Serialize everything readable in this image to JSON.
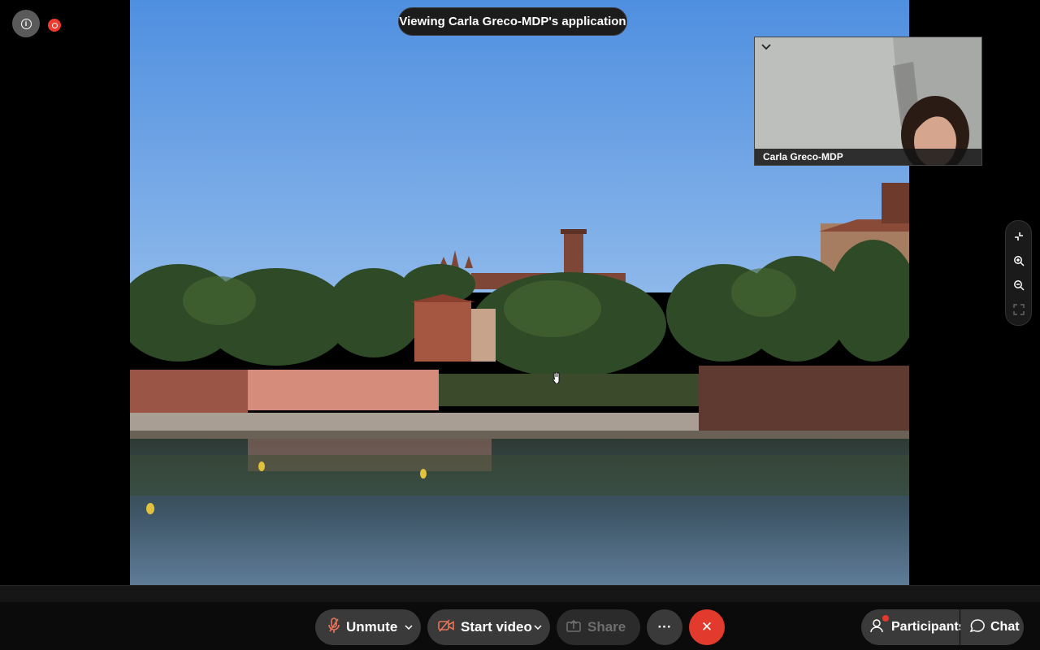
{
  "banner": {
    "text": "Viewing Carla Greco-MDP's application"
  },
  "self_view": {
    "name": "Carla Greco-MDP"
  },
  "icons": {
    "info": "info-icon",
    "recording": "recording-icon",
    "collapse": "chevron-down-icon",
    "exit_fullscreen": "exit-fullscreen-icon",
    "zoom_in": "zoom-in-icon",
    "zoom_out": "zoom-out-icon",
    "fit": "fit-to-window-icon",
    "hand_cursor": "hand-cursor-icon"
  },
  "controls": {
    "unmute_label": "Unmute",
    "start_video_label": "Start video",
    "share_label": "Share",
    "more_label": "···",
    "end_label": "✕"
  },
  "side_controls": {
    "participants_label": "Participants",
    "chat_label": "Chat"
  },
  "colors": {
    "end_button": "#e23a2d",
    "mute_icon": "#e8735a",
    "video_off_icon": "#e8735a",
    "recording": "#ee3b2f"
  }
}
